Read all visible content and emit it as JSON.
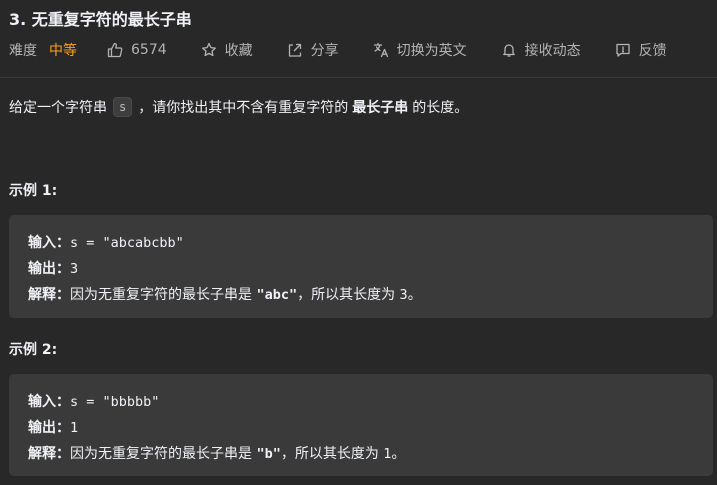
{
  "problem": {
    "title": "3. 无重复字符的最长子串"
  },
  "meta": {
    "difficulty_label": "难度",
    "difficulty_value": "中等",
    "likes": "6574",
    "favorite_label": "收藏",
    "share_label": "分享",
    "translate_label": "切换为英文",
    "notify_label": "接收动态",
    "feedback_label": "反馈"
  },
  "description": {
    "before_code": "给定一个字符串",
    "code": "s",
    "middle": "，请你找出其中不含有重复字符的",
    "bold": "最长子串",
    "after": "的长度。"
  },
  "examples": [
    {
      "title": "示例 1:",
      "input_label": "输入：",
      "input_value": "s = \"abcabcbb\"",
      "output_label": "输出：",
      "output_value": "3",
      "explain_label": "解释：",
      "explain_text": "因为无重复字符的最长子串是 ",
      "explain_code": "\"abc\"",
      "explain_text2": "，所以其长度为 ",
      "explain_num": "3",
      "explain_end": "。"
    },
    {
      "title": "示例 2:",
      "input_label": "输入：",
      "input_value": "s = \"bbbbb\"",
      "output_label": "输出：",
      "output_value": "1",
      "explain_label": "解释：",
      "explain_text": "因为无重复字符的最长子串是 ",
      "explain_code": "\"b\"",
      "explain_text2": "，所以其长度为 ",
      "explain_num": "1",
      "explain_end": "。"
    }
  ],
  "colors": {
    "background": "#282828",
    "code_block": "#3a3a3a",
    "difficulty_medium": "#ffa116",
    "muted_text": "#b3b3b3"
  },
  "icons": [
    "thumbs-up-icon",
    "star-icon",
    "share-icon",
    "translate-icon",
    "bell-icon",
    "feedback-icon"
  ]
}
